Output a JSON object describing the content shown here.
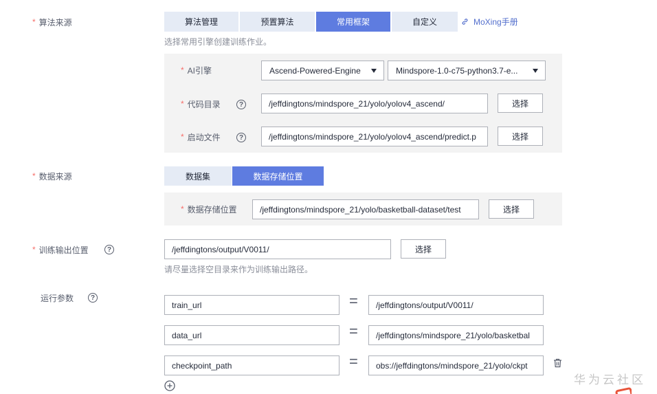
{
  "algorithm_source": {
    "label": "算法来源",
    "tabs": [
      "算法管理",
      "预置算法",
      "常用框架",
      "自定义"
    ],
    "active_tab": 2,
    "moxing_link": "MoXing手册",
    "hint": "选择常用引擎创建训练作业。",
    "ai_engine": {
      "label": "AI引擎",
      "engine_value": "Ascend-Powered-Engine",
      "version_value": "Mindspore-1.0-c75-python3.7-e..."
    },
    "code_dir": {
      "label": "代码目录",
      "value": "/jeffdingtons/mindspore_21/yolo/yolov4_ascend/",
      "button": "选择"
    },
    "boot_file": {
      "label": "启动文件",
      "value": "/jeffdingtons/mindspore_21/yolo/yolov4_ascend/predict.p",
      "button": "选择"
    }
  },
  "data_source": {
    "label": "数据来源",
    "tabs": [
      "数据集",
      "数据存储位置"
    ],
    "active_tab": 1,
    "storage": {
      "label": "数据存储位置",
      "value": "/jeffdingtons/mindspore_21/yolo/basketball-dataset/test",
      "button": "选择"
    }
  },
  "output": {
    "label": "训练输出位置",
    "value": "/jeffdingtons/output/V0011/",
    "button": "选择",
    "hint": "请尽量选择空目录来作为训练输出路径。"
  },
  "params": {
    "label": "运行参数",
    "equals": "=",
    "rows": [
      {
        "key": "train_url",
        "value": "/jeffdingtons/output/V0011/"
      },
      {
        "key": "data_url",
        "value": "/jeffdingtons/mindspore_21/yolo/basketbal"
      },
      {
        "key": "checkpoint_path",
        "value": "obs://jeffdingtons/mindspore_21/yolo/ckpt"
      }
    ]
  },
  "watermark": "华为云社区",
  "colors": {
    "primary": "#5e7ce0",
    "required_star": "#f66f6a",
    "panel_bg": "#f3f3f3",
    "tab_bg": "#e5ebf5"
  },
  "icons": [
    "help-icon",
    "link-icon",
    "caret-down-icon",
    "trash-icon",
    "add-circle-icon"
  ]
}
